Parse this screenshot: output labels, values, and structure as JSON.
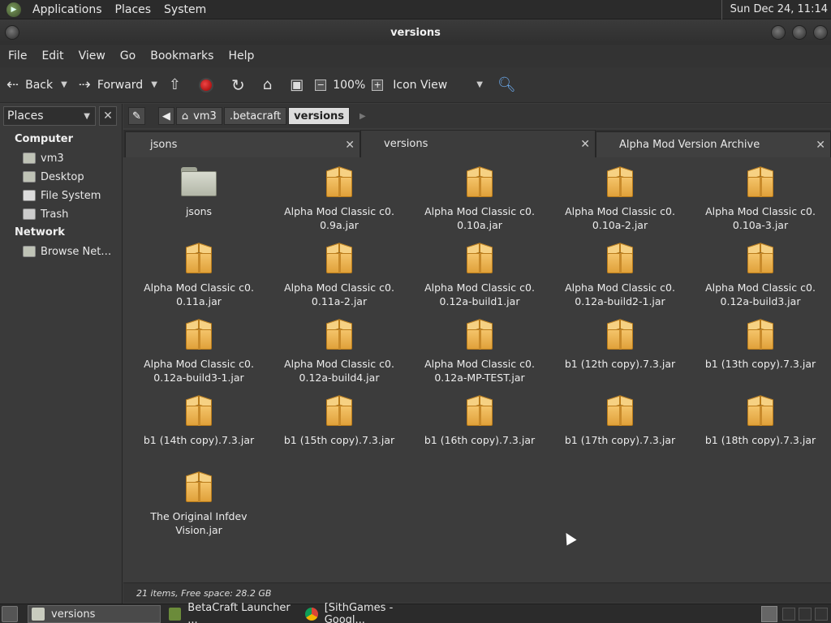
{
  "top_panel": {
    "menus": [
      "Applications",
      "Places",
      "System"
    ],
    "clock": "Sun Dec 24, 11:14"
  },
  "window": {
    "title": "versions"
  },
  "menubar": [
    "File",
    "Edit",
    "View",
    "Go",
    "Bookmarks",
    "Help"
  ],
  "toolbar": {
    "back_label": "Back",
    "forward_label": "Forward",
    "zoom": "100%",
    "view_mode": "Icon View"
  },
  "sidebar": {
    "header": "Places",
    "sections": [
      {
        "title": "Computer",
        "items": [
          "vm3",
          "Desktop",
          "File System",
          "Trash"
        ]
      },
      {
        "title": "Network",
        "items": [
          "Browse Net…"
        ]
      }
    ]
  },
  "location": {
    "crumbs": [
      "vm3",
      ".betacraft",
      "versions"
    ]
  },
  "tabs": [
    {
      "label": "jsons",
      "active": false
    },
    {
      "label": "versions",
      "active": true
    },
    {
      "label": "Alpha Mod Version Archive",
      "active": false
    }
  ],
  "files": [
    {
      "kind": "folder",
      "line1": "jsons",
      "line2": ""
    },
    {
      "kind": "jar",
      "line1": "Alpha Mod Classic c0.",
      "line2": "0.9a.jar"
    },
    {
      "kind": "jar",
      "line1": "Alpha Mod Classic c0.",
      "line2": "0.10a.jar"
    },
    {
      "kind": "jar",
      "line1": "Alpha Mod Classic c0.",
      "line2": "0.10a-2.jar"
    },
    {
      "kind": "jar",
      "line1": "Alpha Mod Classic c0.",
      "line2": "0.10a-3.jar"
    },
    {
      "kind": "jar",
      "line1": "Alpha Mod Classic c0.",
      "line2": "0.11a.jar"
    },
    {
      "kind": "jar",
      "line1": "Alpha Mod Classic c0.",
      "line2": "0.11a-2.jar"
    },
    {
      "kind": "jar",
      "line1": "Alpha Mod Classic c0.",
      "line2": "0.12a-build1.jar"
    },
    {
      "kind": "jar",
      "line1": "Alpha Mod Classic c0.",
      "line2": "0.12a-build2-1.jar"
    },
    {
      "kind": "jar",
      "line1": "Alpha Mod Classic c0.",
      "line2": "0.12a-build3.jar"
    },
    {
      "kind": "jar",
      "line1": "Alpha Mod Classic c0.",
      "line2": "0.12a-build3-1.jar"
    },
    {
      "kind": "jar",
      "line1": "Alpha Mod Classic c0.",
      "line2": "0.12a-build4.jar"
    },
    {
      "kind": "jar",
      "line1": "Alpha Mod Classic c0.",
      "line2": "0.12a-MP-TEST.jar"
    },
    {
      "kind": "jar",
      "line1": "b1 (12th copy).7.3.jar",
      "line2": ""
    },
    {
      "kind": "jar",
      "line1": "b1 (13th copy).7.3.jar",
      "line2": ""
    },
    {
      "kind": "jar",
      "line1": "b1 (14th copy).7.3.jar",
      "line2": ""
    },
    {
      "kind": "jar",
      "line1": "b1 (15th copy).7.3.jar",
      "line2": ""
    },
    {
      "kind": "jar",
      "line1": "b1 (16th copy).7.3.jar",
      "line2": ""
    },
    {
      "kind": "jar",
      "line1": "b1 (17th copy).7.3.jar",
      "line2": ""
    },
    {
      "kind": "jar",
      "line1": "b1 (18th copy).7.3.jar",
      "line2": ""
    },
    {
      "kind": "jar",
      "line1": "The Original Infdev",
      "line2": "Vision.jar"
    }
  ],
  "status": "21 items, Free space: 28.2 GB",
  "taskbar": [
    {
      "label": "versions",
      "active": true,
      "icon": "folder-icon"
    },
    {
      "label": "BetaCraft Launcher ...",
      "active": false,
      "icon": "minecraft-icon"
    },
    {
      "label": "[SithGames - Googl...",
      "active": false,
      "icon": "chrome-icon"
    }
  ]
}
